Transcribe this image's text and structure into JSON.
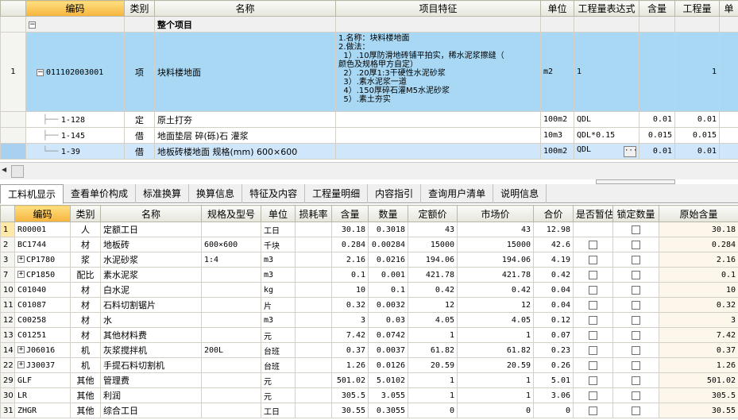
{
  "top_headers": [
    "编码",
    "类别",
    "名称",
    "项目特征",
    "单位",
    "工程量表达式",
    "含量",
    "工程量",
    "单"
  ],
  "group_row": {
    "toggle": "−",
    "name": "整个项目"
  },
  "item_row": {
    "row": "1",
    "toggle": "−",
    "code": "011102003001",
    "type": "项",
    "name": "块料楼地面",
    "features": "1.名称：块料楼地面\n2.做法：\n  1）.10厚防滑地砖铺平拍实，稀水泥浆擦缝（\n颜色及规格甲方自定）\n  2）.20厚1:3干硬性水泥砂浆\n  3）.素水泥浆一道\n  4）.150厚碎石灌M5水泥砂浆\n  5）.素土夯实",
    "unit": "m2",
    "expr": "1",
    "qty": "1"
  },
  "sub_rows": [
    {
      "code": "1-128",
      "type": "定",
      "name": "原土打夯",
      "unit": "100m2",
      "expr": "QDL",
      "content": "0.01",
      "qty": "0.01"
    },
    {
      "code": "1-145",
      "type": "借",
      "name": "地面垫层 碎(砾)石 灌浆",
      "unit": "10m3",
      "expr": "QDL*0.15",
      "content": "0.015",
      "qty": "0.015"
    },
    {
      "code": "1-39",
      "type": "借",
      "name": "地板砖楼地面 规格(mm) 600×600",
      "unit": "100m2",
      "expr": "QDL",
      "content": "0.01",
      "qty": "0.01",
      "dots": "···"
    }
  ],
  "tabs": [
    "工料机显示",
    "查看单价构成",
    "标准换算",
    "换算信息",
    "特征及内容",
    "工程量明细",
    "内容指引",
    "查询用户清单",
    "说明信息"
  ],
  "bottom_headers": [
    "编码",
    "类别",
    "名称",
    "规格及型号",
    "单位",
    "损耗率",
    "含量",
    "数量",
    "定额价",
    "市场价",
    "合价",
    "是否暂估",
    "锁定数量",
    "原始含量"
  ],
  "materials": [
    {
      "no": "1",
      "code": "R00001",
      "type": "人",
      "name": "定额工日",
      "spec": "",
      "unit": "工日",
      "content": "30.18",
      "qty": "0.3018",
      "base": "43",
      "market": "43",
      "total": "12.98",
      "orig": "30.18"
    },
    {
      "no": "2",
      "code": "BC1744",
      "type": "材",
      "name": "地板砖",
      "spec": "600×600",
      "unit": "千块",
      "content": "0.284",
      "qty": "0.00284",
      "base": "15000",
      "market": "15000",
      "total": "42.6",
      "orig": "0.284"
    },
    {
      "no": "3",
      "plus": "+",
      "code": "CP1780",
      "type": "浆",
      "name": "水泥砂浆",
      "spec": "1:4",
      "unit": "m3",
      "content": "2.16",
      "qty": "0.0216",
      "base": "194.06",
      "market": "194.06",
      "total": "4.19",
      "orig": "2.16"
    },
    {
      "no": "7",
      "plus": "+",
      "code": "CP1850",
      "type": "配比",
      "name": "素水泥浆",
      "spec": "",
      "unit": "m3",
      "content": "0.1",
      "qty": "0.001",
      "base": "421.78",
      "market": "421.78",
      "total": "0.42",
      "orig": "0.1"
    },
    {
      "no": "10",
      "code": "C01040",
      "type": "材",
      "name": "白水泥",
      "spec": "",
      "unit": "kg",
      "content": "10",
      "qty": "0.1",
      "base": "0.42",
      "market": "0.42",
      "total": "0.04",
      "orig": "10"
    },
    {
      "no": "11",
      "code": "C01087",
      "type": "材",
      "name": "石料切割锯片",
      "spec": "",
      "unit": "片",
      "content": "0.32",
      "qty": "0.0032",
      "base": "12",
      "market": "12",
      "total": "0.04",
      "orig": "0.32"
    },
    {
      "no": "12",
      "code": "C00258",
      "type": "材",
      "name": "水",
      "spec": "",
      "unit": "m3",
      "content": "3",
      "qty": "0.03",
      "base": "4.05",
      "market": "4.05",
      "total": "0.12",
      "orig": "3"
    },
    {
      "no": "13",
      "code": "C01251",
      "type": "材",
      "name": "其他材料费",
      "spec": "",
      "unit": "元",
      "content": "7.42",
      "qty": "0.0742",
      "base": "1",
      "market": "1",
      "total": "0.07",
      "orig": "7.42"
    },
    {
      "no": "14",
      "plus": "+",
      "code": "J06016",
      "type": "机",
      "name": "灰浆搅拌机",
      "spec": "200L",
      "unit": "台班",
      "content": "0.37",
      "qty": "0.0037",
      "base": "61.82",
      "market": "61.82",
      "total": "0.23",
      "orig": "0.37"
    },
    {
      "no": "22",
      "plus": "+",
      "code": "J30037",
      "type": "机",
      "name": "手提石料切割机",
      "spec": "",
      "unit": "台班",
      "content": "1.26",
      "qty": "0.0126",
      "base": "20.59",
      "market": "20.59",
      "total": "0.26",
      "orig": "1.26"
    },
    {
      "no": "29",
      "code": "GLF",
      "type": "其他",
      "name": "管理费",
      "spec": "",
      "unit": "元",
      "content": "501.02",
      "qty": "5.0102",
      "base": "1",
      "market": "1",
      "total": "5.01",
      "orig": "501.02"
    },
    {
      "no": "30",
      "code": "LR",
      "type": "其他",
      "name": "利润",
      "spec": "",
      "unit": "元",
      "content": "305.5",
      "qty": "3.055",
      "base": "1",
      "market": "1",
      "total": "3.06",
      "orig": "305.5"
    },
    {
      "no": "31",
      "code": "ZHGR",
      "type": "其他",
      "name": "综合工日",
      "spec": "",
      "unit": "工日",
      "content": "30.55",
      "qty": "0.3055",
      "base": "0",
      "market": "0",
      "total": "0",
      "orig": "30.55"
    }
  ]
}
